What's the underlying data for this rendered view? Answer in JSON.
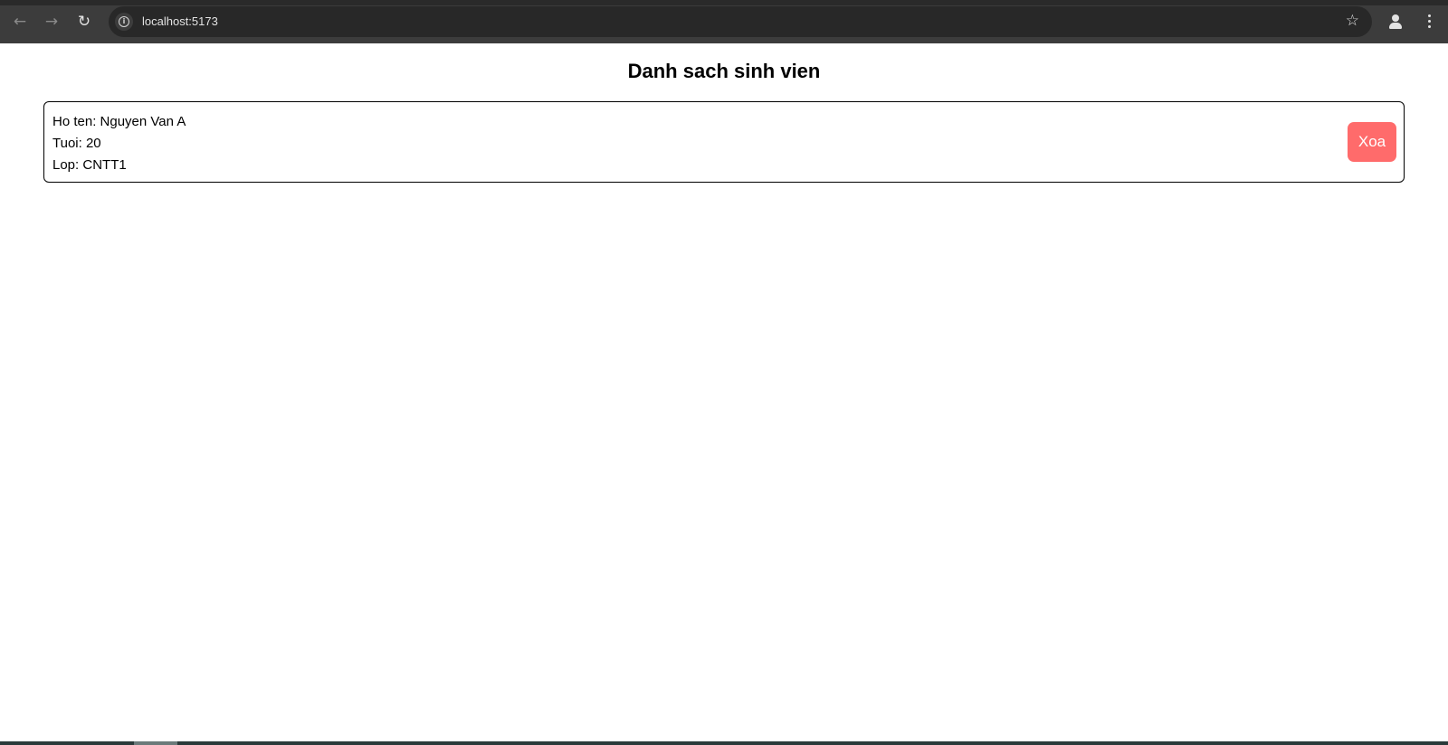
{
  "browser": {
    "url": "localhost:5173",
    "back_icon": "←",
    "forward_icon": "→",
    "reload_icon": "↻",
    "star_icon": "☆"
  },
  "page": {
    "title": "Danh sach sinh vien"
  },
  "student": {
    "name_line": "Ho ten: Nguyen Van A",
    "age_line": "Tuoi: 20",
    "class_line": "Lop: CNTT1",
    "delete_label": "Xoa"
  },
  "colors": {
    "delete_button": "#ff6b6b",
    "browser_chrome": "#3c3c3c",
    "omnibox": "#282828"
  }
}
